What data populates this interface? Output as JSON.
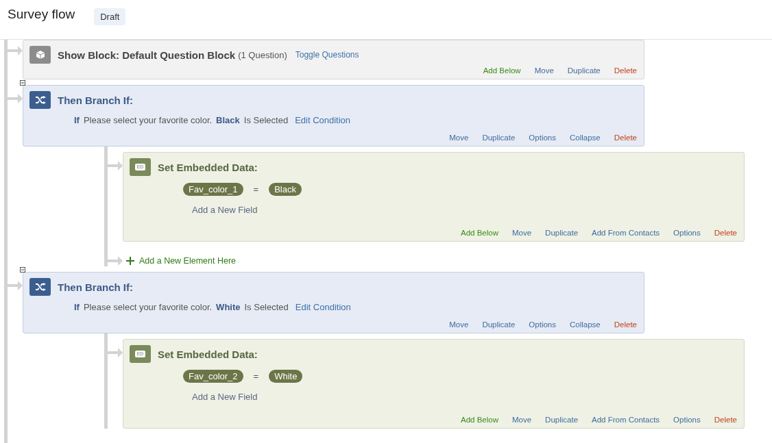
{
  "header": {
    "title": "Survey flow",
    "status": "Draft"
  },
  "flow": [
    {
      "kind": "block",
      "title": "Show Block: Default Question Block",
      "count": "(1 Question)",
      "link": "Toggle Questions",
      "actions": [
        {
          "label": "Add Below",
          "kind": "add"
        },
        {
          "label": "Move",
          "kind": "link"
        },
        {
          "label": "Duplicate",
          "kind": "link"
        },
        {
          "label": "Delete",
          "kind": "delete"
        }
      ]
    },
    {
      "kind": "branch",
      "expanded": true,
      "title": "Then Branch If:",
      "condition": {
        "if": "If",
        "question": "Please select your favorite color.",
        "choice": "Black",
        "operator": "Is Selected",
        "link": "Edit Condition"
      },
      "actions": [
        {
          "label": "Move",
          "kind": "link"
        },
        {
          "label": "Duplicate",
          "kind": "link"
        },
        {
          "label": "Options",
          "kind": "link"
        },
        {
          "label": "Collapse",
          "kind": "link"
        },
        {
          "label": "Delete",
          "kind": "delete"
        }
      ],
      "children": [
        {
          "kind": "embedded",
          "icon_label": "ED",
          "title": "Set Embedded Data:",
          "fields": [
            {
              "name": "Fav_color_1",
              "operator": "=",
              "value": "Black"
            }
          ],
          "add_field": "Add a New Field",
          "actions": [
            {
              "label": "Add Below",
              "kind": "add"
            },
            {
              "label": "Move",
              "kind": "link"
            },
            {
              "label": "Duplicate",
              "kind": "link"
            },
            {
              "label": "Add From Contacts",
              "kind": "link"
            },
            {
              "label": "Options",
              "kind": "link"
            },
            {
              "label": "Delete",
              "kind": "delete"
            }
          ]
        }
      ],
      "add_element": "Add a New Element Here"
    },
    {
      "kind": "branch",
      "expanded": true,
      "title": "Then Branch If:",
      "condition": {
        "if": "If",
        "question": "Please select your favorite color.",
        "choice": "White",
        "operator": "Is Selected",
        "link": "Edit Condition"
      },
      "actions": [
        {
          "label": "Move",
          "kind": "link"
        },
        {
          "label": "Duplicate",
          "kind": "link"
        },
        {
          "label": "Options",
          "kind": "link"
        },
        {
          "label": "Collapse",
          "kind": "link"
        },
        {
          "label": "Delete",
          "kind": "delete"
        }
      ],
      "children": [
        {
          "kind": "embedded",
          "icon_label": "ED",
          "title": "Set Embedded Data:",
          "fields": [
            {
              "name": "Fav_color_2",
              "operator": "=",
              "value": "White"
            }
          ],
          "add_field": "Add a New Field",
          "actions": [
            {
              "label": "Add Below",
              "kind": "add"
            },
            {
              "label": "Move",
              "kind": "link"
            },
            {
              "label": "Duplicate",
              "kind": "link"
            },
            {
              "label": "Add From Contacts",
              "kind": "link"
            },
            {
              "label": "Options",
              "kind": "link"
            },
            {
              "label": "Delete",
              "kind": "delete"
            }
          ]
        }
      ]
    }
  ]
}
